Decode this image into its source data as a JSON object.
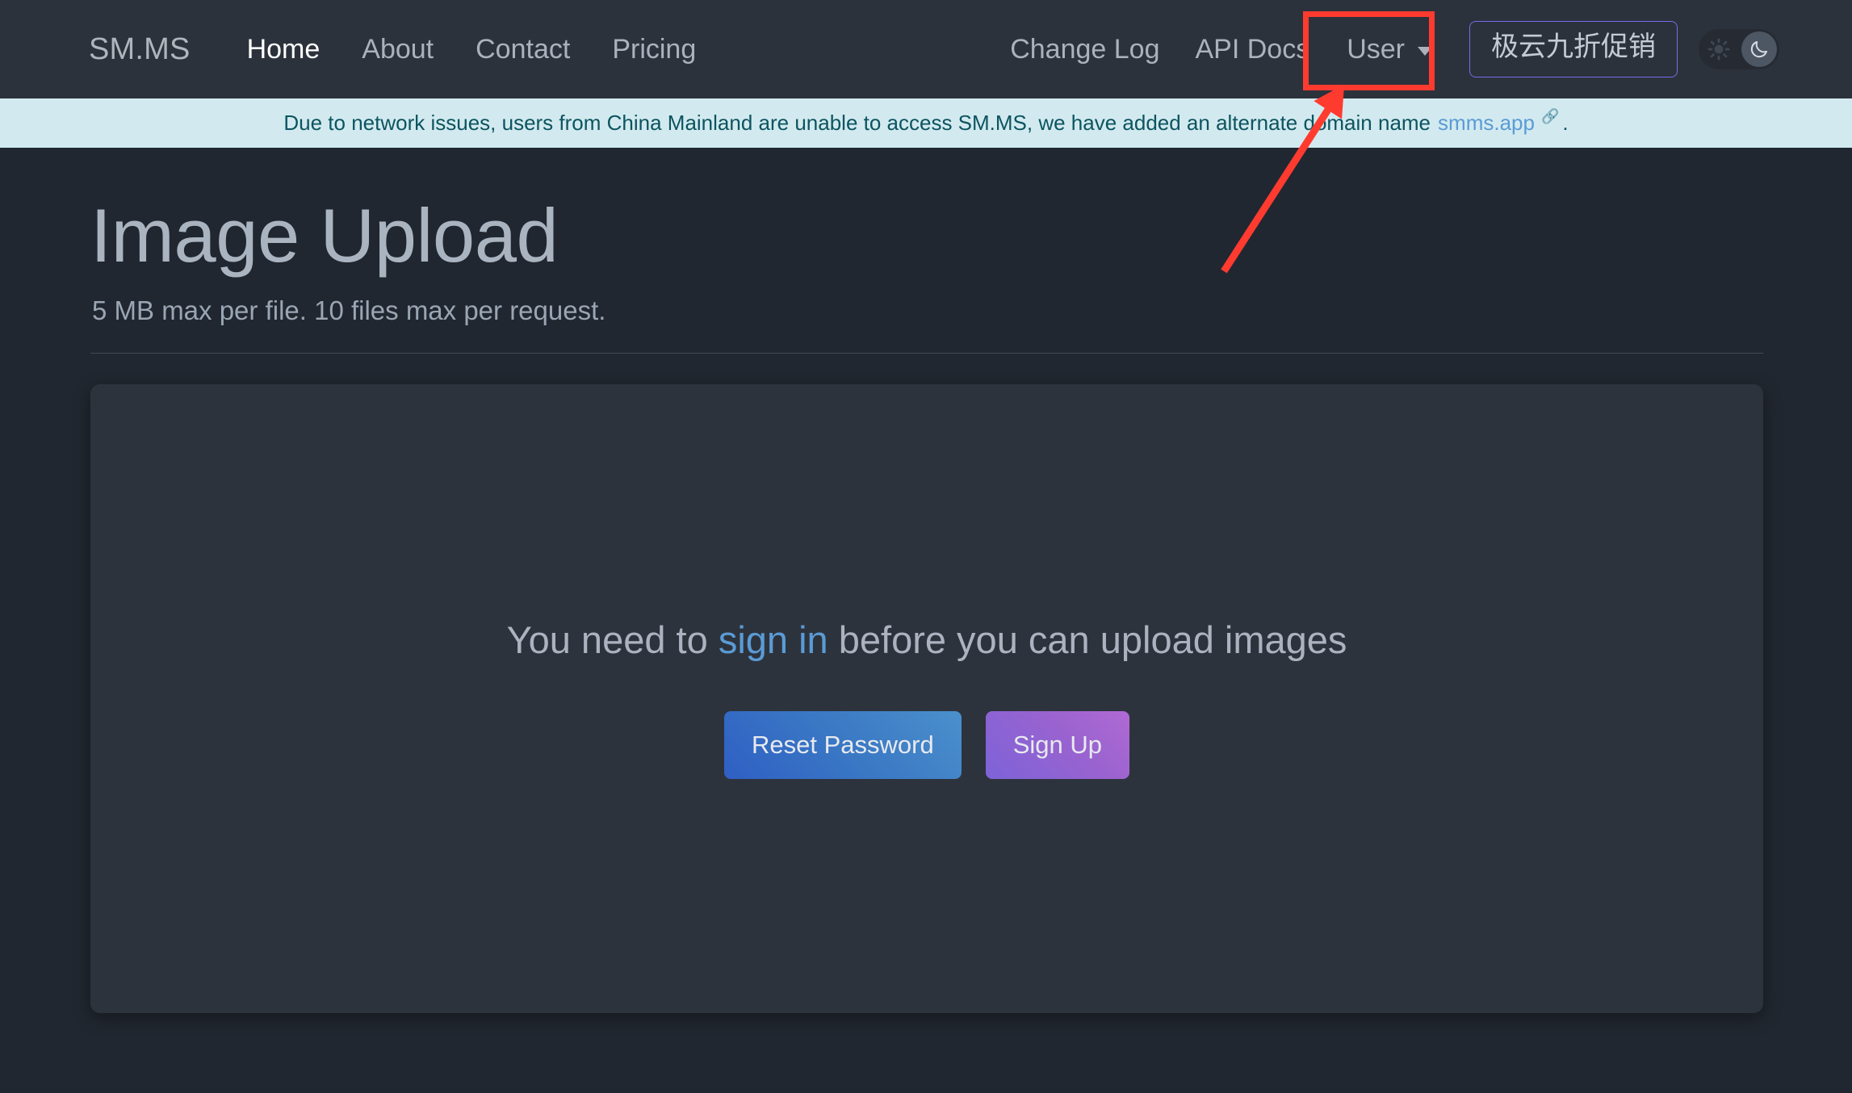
{
  "navbar": {
    "brand": "SM.MS",
    "left_links": [
      {
        "label": "Home",
        "active": true
      },
      {
        "label": "About",
        "active": false
      },
      {
        "label": "Contact",
        "active": false
      },
      {
        "label": "Pricing",
        "active": false
      }
    ],
    "right_links": [
      {
        "label": "Change Log"
      },
      {
        "label": "API Docs"
      }
    ],
    "user_menu": {
      "label": "User",
      "caret_icon": "chevron-down-icon"
    },
    "promo_button": {
      "label": "极云九折促销"
    },
    "theme_toggle": {
      "light_icon": "sun-icon",
      "dark_icon": "moon-icon",
      "active_mode": "dark"
    }
  },
  "banner": {
    "text_before": "Due to network issues, users from China Mainland are unable to access SM.MS, we have added an alternate domain name",
    "link_label": "smms.app",
    "link_icon": "external-link-icon",
    "text_after": "."
  },
  "main": {
    "title": "Image Upload",
    "subtitle": "5 MB max per file. 10 files max per request.",
    "dropzone": {
      "message_before": "You need to ",
      "sign_in_label": "sign in",
      "message_after": " before you can upload images",
      "buttons": [
        {
          "label": "Reset Password",
          "style": "reset"
        },
        {
          "label": "Sign Up",
          "style": "signup"
        }
      ]
    }
  },
  "annotations": {
    "highlight_target": "User",
    "highlight_color": "#ff3b30",
    "arrow_color": "#ff3b30"
  }
}
